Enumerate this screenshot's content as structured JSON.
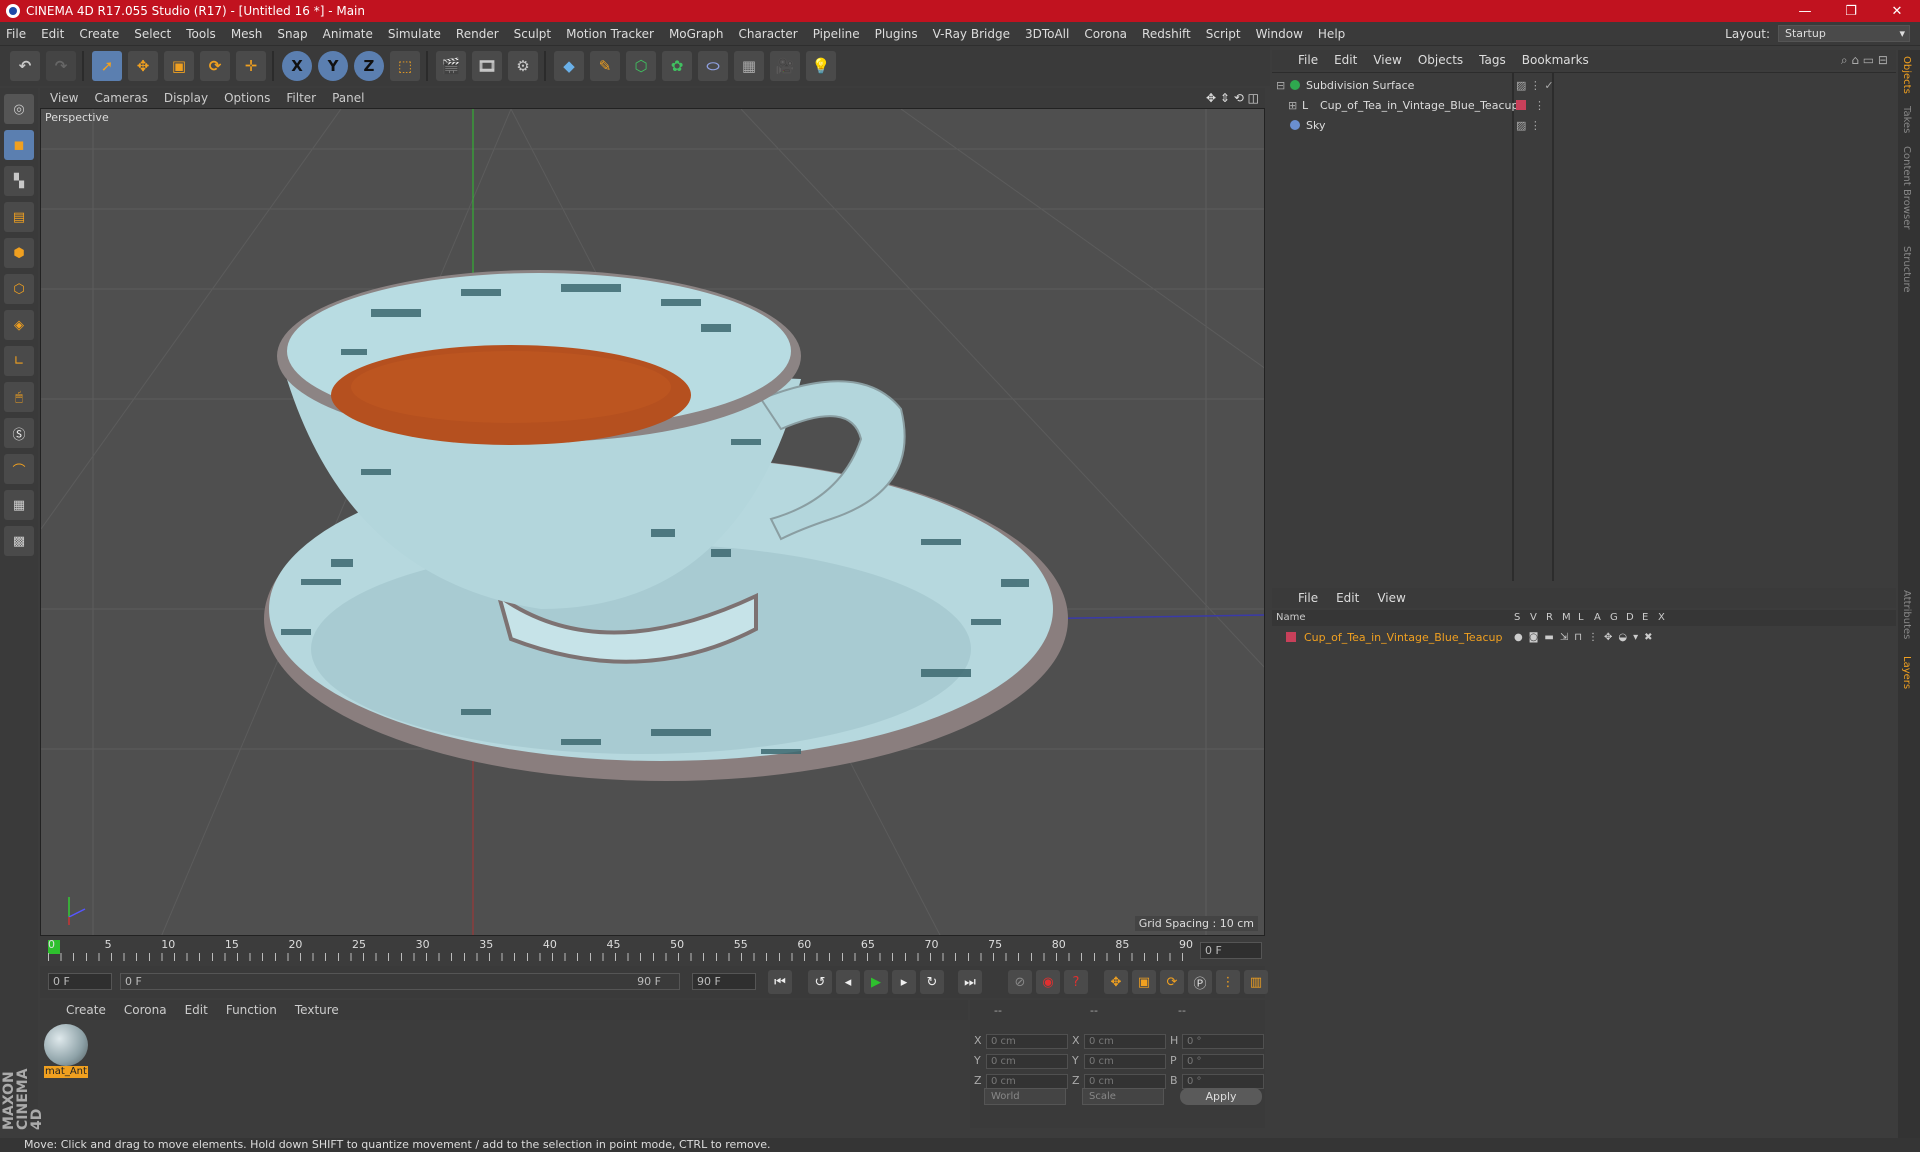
{
  "window": {
    "title": "CINEMA 4D R17.055 Studio (R17) - [Untitled 16 *] - Main"
  },
  "menubar": {
    "items": [
      "File",
      "Edit",
      "Create",
      "Select",
      "Tools",
      "Mesh",
      "Snap",
      "Animate",
      "Simulate",
      "Render",
      "Sculpt",
      "Motion Tracker",
      "MoGraph",
      "Character",
      "Pipeline",
      "Plugins",
      "V-Ray Bridge",
      "3DToAll",
      "Corona",
      "Redshift",
      "Script",
      "Window",
      "Help"
    ]
  },
  "layout": {
    "label": "Layout:",
    "value": "Startup"
  },
  "toolbar": {
    "axis_x": "X",
    "axis_y": "Y",
    "axis_z": "Z"
  },
  "viewport": {
    "menu": [
      "View",
      "Cameras",
      "Display",
      "Options",
      "Filter",
      "Panel"
    ],
    "label": "Perspective",
    "grid_spacing": "Grid Spacing : 10 cm"
  },
  "timeline": {
    "ticks": [
      "0",
      "5",
      "10",
      "15",
      "20",
      "25",
      "30",
      "35",
      "40",
      "45",
      "50",
      "55",
      "60",
      "65",
      "70",
      "75",
      "80",
      "85",
      "90"
    ],
    "current_frame": "0 F",
    "start_field": "0 F",
    "range_start": "0 F",
    "range_end": "90 F",
    "end_field": "90 F"
  },
  "material_manager": {
    "menu": [
      "Create",
      "Corona",
      "Edit",
      "Function",
      "Texture"
    ],
    "materials": [
      {
        "name": "mat_Ant"
      }
    ]
  },
  "coordinates": {
    "header": [
      "--",
      "--",
      "--"
    ],
    "rows": [
      {
        "l1": "X",
        "v1": "0 cm",
        "l2": "X",
        "v2": "0 cm",
        "l3": "H",
        "v3": "0 °"
      },
      {
        "l1": "Y",
        "v1": "0 cm",
        "l2": "Y",
        "v2": "0 cm",
        "l3": "P",
        "v3": "0 °"
      },
      {
        "l1": "Z",
        "v1": "0 cm",
        "l2": "Z",
        "v2": "0 cm",
        "l3": "B",
        "v3": "0 °"
      }
    ],
    "world": "World",
    "scale": "Scale",
    "apply": "Apply"
  },
  "object_manager": {
    "menu": [
      "File",
      "Edit",
      "View",
      "Objects",
      "Tags",
      "Bookmarks"
    ],
    "objects": [
      {
        "name": "Subdivision Surface",
        "color": "#2fa84f"
      },
      {
        "name": "Cup_of_Tea_in_Vintage_Blue_Teacup",
        "color": "#c8405a"
      },
      {
        "name": "Sky",
        "color": "#6a8fd0"
      }
    ]
  },
  "layer_manager": {
    "menu": [
      "File",
      "Edit",
      "View"
    ],
    "columns": [
      "Name",
      "S",
      "V",
      "R",
      "M",
      "L",
      "A",
      "G",
      "D",
      "E",
      "X"
    ],
    "layers": [
      {
        "name": "Cup_of_Tea_in_Vintage_Blue_Teacup",
        "color": "#c8405a"
      }
    ]
  },
  "right_tabs": [
    "Objects",
    "Takes",
    "Content Browser",
    "Structure",
    "Attributes",
    "Layers"
  ],
  "status": "Move: Click and drag to move elements. Hold down SHIFT to quantize movement / add to the selection in point mode, CTRL to remove.",
  "brand": "MAXON CINEMA 4D",
  "colors": {
    "title_bar": "#c1121f",
    "accent": "#f0a020",
    "tea": "#b5501f",
    "porcelain": "#b8dde3"
  }
}
